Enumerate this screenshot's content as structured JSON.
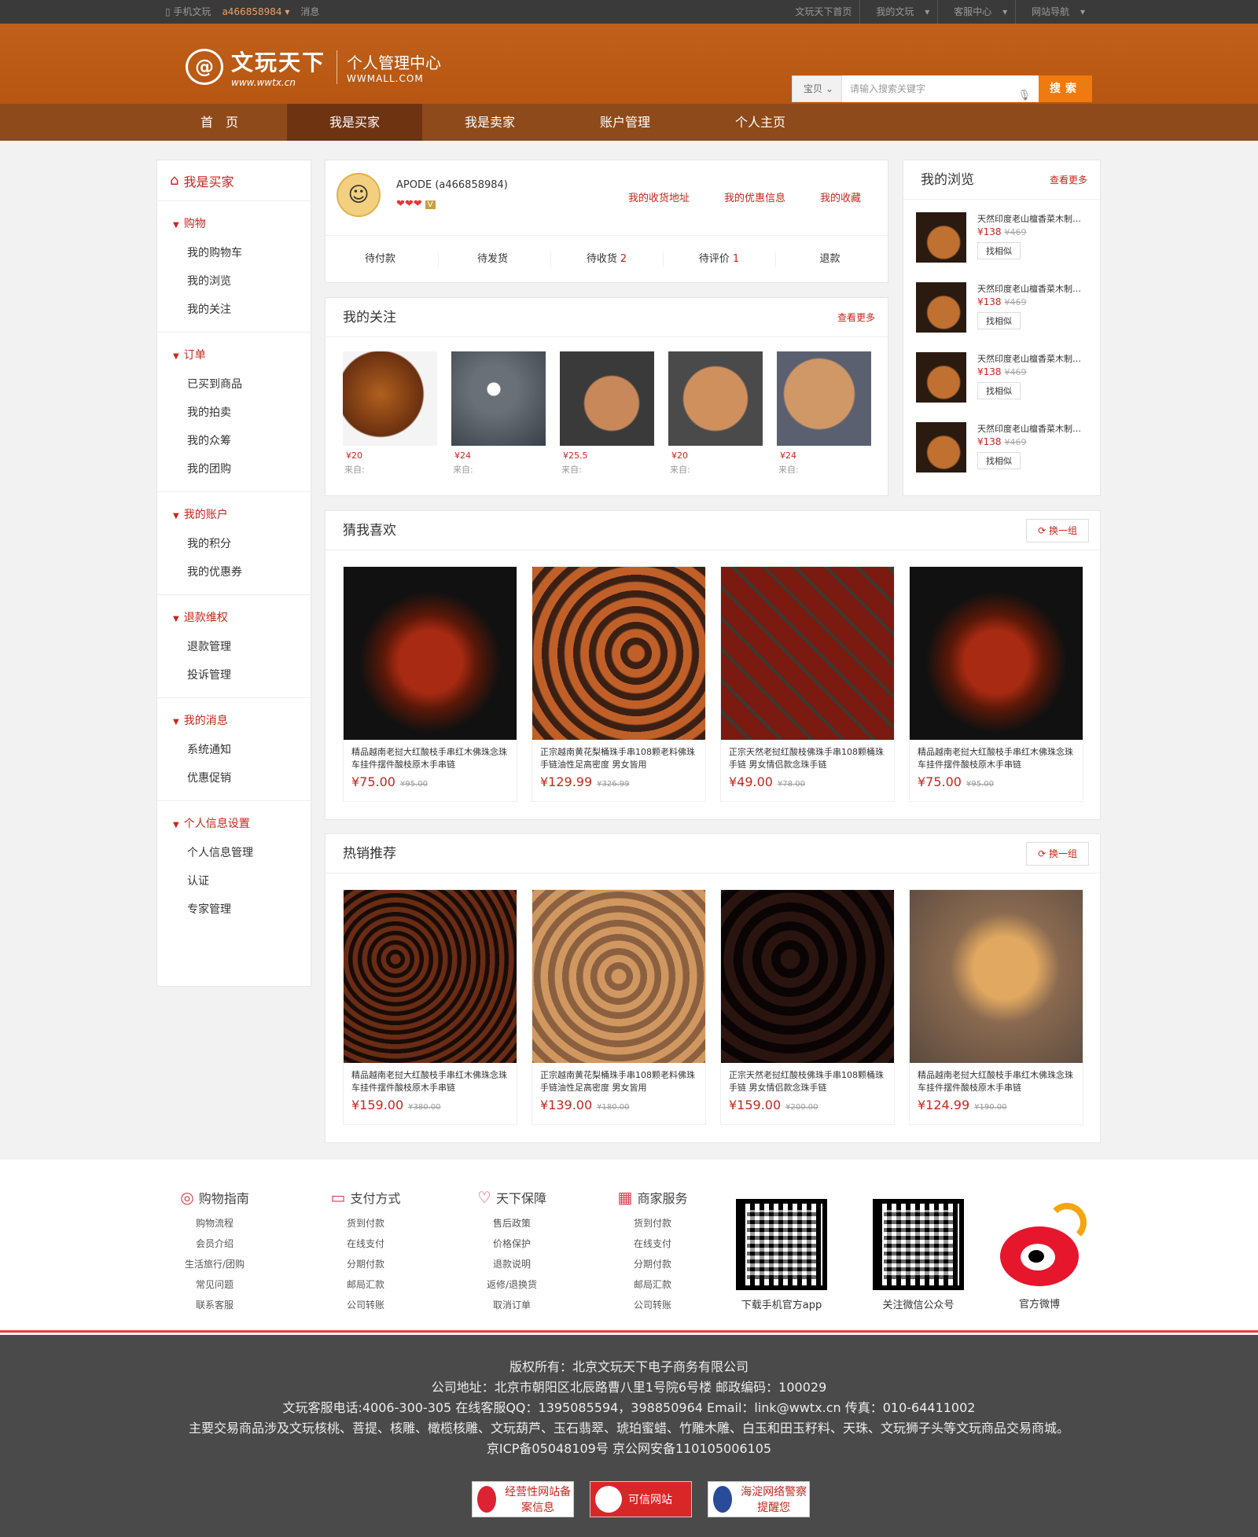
{
  "topbar": {
    "mobile": "手机文玩",
    "user": "a466858984",
    "message": "消息",
    "right": [
      "文玩天下首页",
      "我的文玩",
      "客服中心",
      "网站导航"
    ]
  },
  "header": {
    "logo_cn": "文玩天下",
    "logo_url": "www.wwtx.cn",
    "center_title": "个人管理中心",
    "center_sub": "WWMALL.COM",
    "search_cat": "宝贝",
    "search_placeholder": "请输入搜索关键字",
    "search_btn": "搜索"
  },
  "nav": [
    "首　页",
    "我是买家",
    "我是卖家",
    "账户管理",
    "个人主页"
  ],
  "sidebar": {
    "title": "我是买家",
    "groups": [
      {
        "title": "购物",
        "items": [
          "我的购物车",
          "我的浏览",
          "我的关注"
        ]
      },
      {
        "title": "订单",
        "items": [
          "已买到商品",
          "我的拍卖",
          "我的众筹",
          "我的团购"
        ]
      },
      {
        "title": "我的账户",
        "items": [
          "我的积分",
          "我的优惠券"
        ]
      },
      {
        "title": "退款维权",
        "items": [
          "退款管理",
          "投诉管理"
        ]
      },
      {
        "title": "我的消息",
        "items": [
          "系统通知",
          "优惠促销"
        ]
      },
      {
        "title": "个人信息设置",
        "items": [
          "个人信息管理",
          "认证",
          "专家管理"
        ]
      }
    ]
  },
  "profile": {
    "name": "APODE (a466858984)",
    "links": [
      "我的收货地址",
      "我的优惠信息",
      "我的收藏"
    ],
    "tabs": [
      {
        "label": "待付款",
        "count": ""
      },
      {
        "label": "待发货",
        "count": ""
      },
      {
        "label": "待收货",
        "count": "2"
      },
      {
        "label": "待评价",
        "count": "1"
      },
      {
        "label": "退款",
        "count": ""
      }
    ]
  },
  "follow": {
    "title": "我的关注",
    "more": "查看更多",
    "items": [
      {
        "price": "¥20",
        "from": "来自:"
      },
      {
        "price": "¥24",
        "from": "来自:"
      },
      {
        "price": "¥25.5",
        "from": "来自:"
      },
      {
        "price": "¥20",
        "from": "来自:"
      },
      {
        "price": "¥24",
        "from": "来自:"
      }
    ]
  },
  "browse": {
    "title": "我的浏览",
    "more": "查看更多",
    "items": [
      {
        "title": "天然印度老山檀香菜木制…",
        "price": "¥138",
        "old": "¥469",
        "btn": "找相似"
      },
      {
        "title": "天然印度老山檀香菜木制…",
        "price": "¥138",
        "old": "¥469",
        "btn": "找相似"
      },
      {
        "title": "天然印度老山檀香菜木制…",
        "price": "¥138",
        "old": "¥469",
        "btn": "找相似"
      },
      {
        "title": "天然印度老山檀香菜木制…",
        "price": "¥138",
        "old": "¥469",
        "btn": "找相似"
      }
    ]
  },
  "guess": {
    "title": "猜我喜欢",
    "refresh": "换一组",
    "items": [
      {
        "title": "精品越南老挝大红酸枝手串红木佛珠念珠车挂件摆件酸枝原木手串链",
        "price": "¥75.00",
        "old": "¥95.00"
      },
      {
        "title": "正宗越南黄花梨桶珠手串108颗老料佛珠手链油性足高密度 男女皆用",
        "price": "¥129.99",
        "old": "¥326.99"
      },
      {
        "title": "正宗天然老挝红酸枝佛珠手串108颗桶珠手链 男女情侣款念珠手链",
        "price": "¥49.00",
        "old": "¥78.00"
      },
      {
        "title": "精品越南老挝大红酸枝手串红木佛珠念珠车挂件摆件酸枝原木手串链",
        "price": "¥75.00",
        "old": "¥95.00"
      }
    ]
  },
  "hot": {
    "title": "热销推荐",
    "refresh": "换一组",
    "items": [
      {
        "title": "精品越南老挝大红酸枝手串红木佛珠念珠车挂件摆件酸枝原木手串链",
        "price": "¥159.00",
        "old": "¥380.00"
      },
      {
        "title": "正宗越南黄花梨桶珠手串108颗老料佛珠手链油性足高密度 男女皆用",
        "price": "¥139.00",
        "old": "¥180.00"
      },
      {
        "title": "正宗天然老挝红酸枝佛珠手串108颗桶珠手链 男女情侣款念珠手链",
        "price": "¥159.00",
        "old": "¥200.00"
      },
      {
        "title": "精品越南老挝大红酸枝手串红木佛珠念珠车挂件摆件酸枝原木手串链",
        "price": "¥124.99",
        "old": "¥190.00"
      }
    ]
  },
  "footer": {
    "cols": [
      {
        "title": "购物指南",
        "links": [
          "购物流程",
          "会员介绍",
          "生活旅行/团购",
          "常见问题",
          "联系客服"
        ]
      },
      {
        "title": "支付方式",
        "links": [
          "货到付款",
          "在线支付",
          "分期付款",
          "邮局汇款",
          "公司转账"
        ]
      },
      {
        "title": "天下保障",
        "links": [
          "售后政策",
          "价格保护",
          "退款说明",
          "返修/退换货",
          "取消订单"
        ]
      },
      {
        "title": "商家服务",
        "links": [
          "货到付款",
          "在线支付",
          "分期付款",
          "邮局汇款",
          "公司转账"
        ]
      }
    ],
    "qr_app": "下载手机官方app",
    "qr_wechat": "关注微信公众号",
    "weibo": "官方微博"
  },
  "bottom": {
    "lines": [
      "版权所有：北京文玩天下电子商务有限公司",
      "公司地址：北京市朝阳区北辰路曹八里1号院6号楼 邮政编码：100029",
      "文玩客服电话:4006-300-305 在线客服QQ：1395085594，398850964 Email：link@wwtx.cn 传真：010-64411002",
      "主要交易商品涉及文玩核桃、菩提、核雕、橄榄核雕、文玩葫芦、玉石翡翠、琥珀蜜蜡、竹雕木雕、白玉和田玉籽料、天珠、文玩狮子头等文玩商品交易商城。",
      "京ICP备05048109号 京公网安备110105006105"
    ],
    "badges": [
      "经营性网站备案信息",
      "可信网站",
      "海淀网络警察提醒您"
    ]
  },
  "colors": {
    "accent": "#c8261c",
    "header": "#b65612",
    "nav": "#8e4a1a"
  }
}
